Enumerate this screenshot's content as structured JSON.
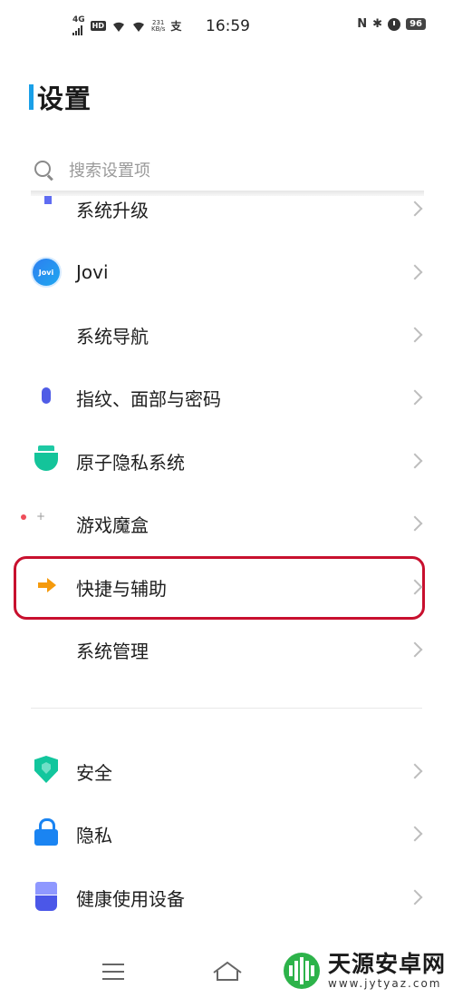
{
  "status_bar": {
    "network": "4G",
    "hd": "HD",
    "speed_value": "231",
    "speed_unit": "KB/s",
    "app_glyph": "支",
    "time": "16:59",
    "nfc": "N",
    "bluetooth": "✱",
    "battery": "96"
  },
  "header": {
    "title": "设置"
  },
  "search": {
    "placeholder": "搜索设置项"
  },
  "settings_items": [
    {
      "label": "系统升级",
      "icon": "system-upgrade-icon"
    },
    {
      "label": "Jovi",
      "icon": "jovi-icon",
      "icon_text": "Jovi"
    },
    {
      "label": "系统导航",
      "icon": "system-navigation-icon"
    },
    {
      "label": "指纹、面部与密码",
      "icon": "fingerprint-icon"
    },
    {
      "label": "原子隐私系统",
      "icon": "atom-privacy-icon"
    },
    {
      "label": "游戏魔盒",
      "icon": "game-box-icon"
    },
    {
      "label": "快捷与辅助",
      "icon": "shortcut-assist-icon"
    },
    {
      "label": "系统管理",
      "icon": "system-management-icon"
    },
    {
      "label": "安全",
      "icon": "security-shield-icon"
    },
    {
      "label": "隐私",
      "icon": "privacy-lock-icon"
    },
    {
      "label": "健康使用设备",
      "icon": "healthy-usage-icon"
    }
  ],
  "watermark": {
    "name": "天源安卓网",
    "url": "www.jytyaz.com"
  },
  "colors": {
    "title_accent": "#1aa0e8",
    "highlight_border": "#c8102e"
  }
}
